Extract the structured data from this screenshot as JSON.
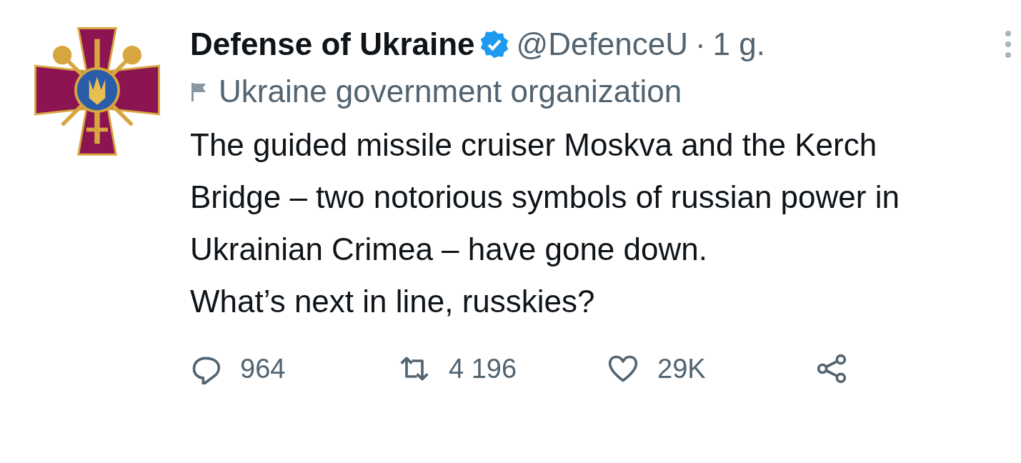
{
  "tweet": {
    "author": {
      "name": "Defense of Ukraine",
      "verified": true,
      "handle": "@DefenceU",
      "separator": "·",
      "time": "1 g."
    },
    "label": "Ukraine government organization",
    "text": [
      "The guided missile cruiser Moskva and the Kerch Bridge – two notorious symbols of russian power in Ukrainian Crimea – have gone down.",
      "What’s next in line, russkies?"
    ],
    "actions": [
      {
        "kind": "reply",
        "count": "964"
      },
      {
        "kind": "retweet",
        "count": "4 196"
      },
      {
        "kind": "like",
        "count": "29K"
      },
      {
        "kind": "share"
      }
    ]
  }
}
